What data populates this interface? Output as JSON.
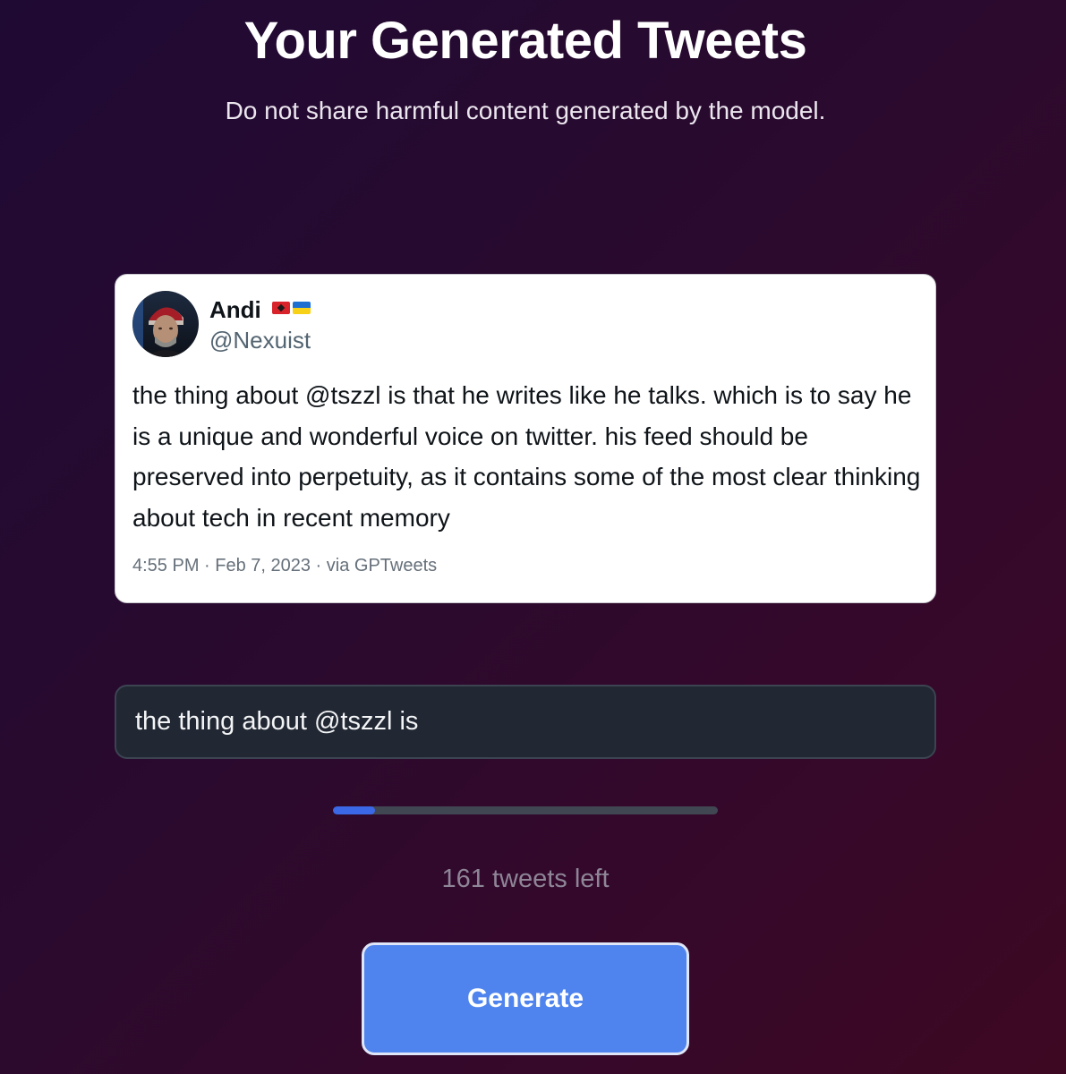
{
  "header": {
    "title": "Your Generated Tweets",
    "subtitle": "Do not share harmful content generated by the model."
  },
  "tweet": {
    "author_name": "Andi",
    "author_flags": [
      "albania-flag-icon",
      "ukraine-flag-icon"
    ],
    "author_handle": "@Nexuist",
    "avatar": "user-avatar-photo",
    "text": "the thing about @tszzl is that he writes like he talks. which is to say he is a unique and wonderful voice on twitter. his feed should be preserved into perpetuity, as it contains some of the most clear thinking about tech in recent memory",
    "meta": "4:55 PM · Feb 7, 2023 · via GPTweets"
  },
  "prompt": {
    "value": "the thing about @tszzl is"
  },
  "usage": {
    "progress_fraction": 0.11,
    "tweets_left_label": "161 tweets left"
  },
  "actions": {
    "generate_label": "Generate"
  },
  "colors": {
    "accent": "#4f84ee",
    "progress_fill": "#3a68e6",
    "background_start": "#1f0a34",
    "background_end": "#3d0822"
  }
}
